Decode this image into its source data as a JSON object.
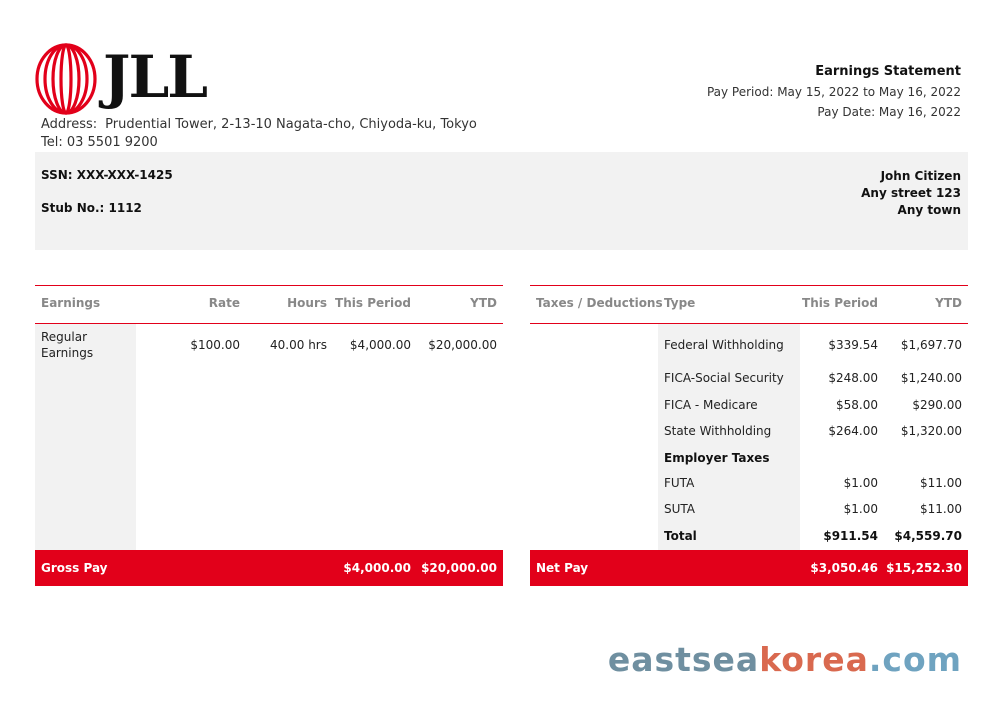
{
  "company": {
    "logo_text": "JLL",
    "address_label": "Address:",
    "address": "Prudential Tower, 2-13-10  Nagata-cho, Chiyoda-ku, Tokyo",
    "tel": "Tel: 03 5501 9200"
  },
  "statement": {
    "title": "Earnings Statement",
    "pay_period": "Pay Period: May 15, 2022 to May 16, 2022",
    "pay_date": "Pay Date: May 16, 2022"
  },
  "employee": {
    "ssn": "SSN: XXX-XXX-1425",
    "stub": "Stub No.: 1112",
    "name": "John Citizen",
    "street": "Any street 123",
    "town": "Any town"
  },
  "earnings": {
    "headers": [
      "Earnings",
      "Rate",
      "Hours",
      "This Period",
      "YTD"
    ],
    "row": {
      "label_line1": "Regular",
      "label_line2": "Earnings",
      "rate": "$100.00",
      "hours": "40.00 hrs",
      "this_period": "$4,000.00",
      "ytd": "$20,000.00"
    },
    "gross_label": "Gross Pay",
    "gross_period": "$4,000.00",
    "gross_ytd": "$20,000.00"
  },
  "taxes": {
    "headers": [
      "Taxes / Deductions",
      "Type",
      "This Period",
      "YTD"
    ],
    "rows": [
      {
        "type": "Federal Withholding",
        "period": "$339.54",
        "ytd": "$1,697.70"
      },
      {
        "type": "FICA-Social Security",
        "period": "$248.00",
        "ytd": "$1,240.00"
      },
      {
        "type": "FICA - Medicare",
        "period": "$58.00",
        "ytd": "$290.00"
      },
      {
        "type": "State Withholding",
        "period": "$264.00",
        "ytd": "$1,320.00"
      },
      {
        "type": "Employer Taxes",
        "period": "",
        "ytd": ""
      },
      {
        "type": "FUTA",
        "period": "$1.00",
        "ytd": "$11.00"
      },
      {
        "type": "SUTA",
        "period": "$1.00",
        "ytd": "$11.00"
      },
      {
        "type": "Total",
        "period": "$911.54",
        "ytd": "$4,559.70"
      }
    ],
    "net_label": "Net Pay",
    "net_period": "$3,050.46",
    "net_ytd": "$15,252.30"
  },
  "watermark": {
    "part1": "eastsea",
    "part2": "korea",
    "part3": ".com",
    "colors": [
      "#6f8fa0",
      "#d9694f",
      "#6fa3c0"
    ]
  },
  "colors": {
    "accent": "#e2001a",
    "panel": "#f2f2f2"
  }
}
